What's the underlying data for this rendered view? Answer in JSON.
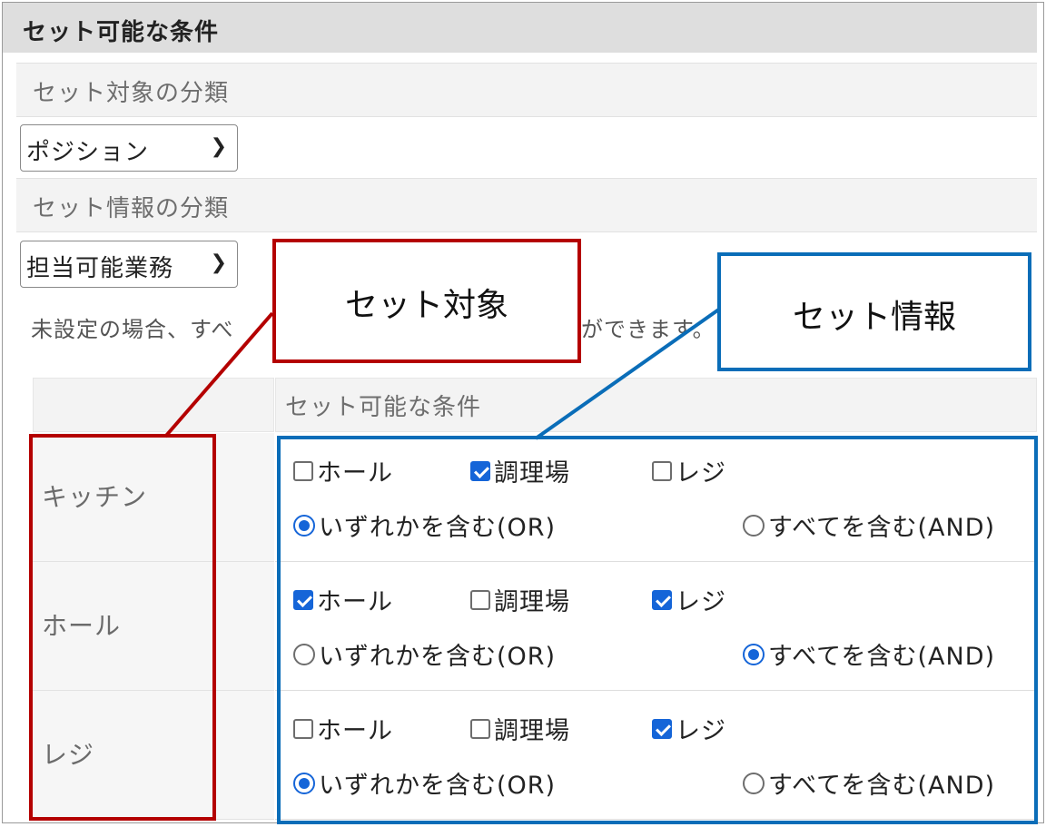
{
  "header": {
    "title": "セット可能な条件"
  },
  "target_section": {
    "label": "セット対象の分類",
    "select_value": "ポジション"
  },
  "info_section": {
    "label": "セット情報の分類",
    "select_value": "担当可能業務"
  },
  "note": "未設定の場合、すべ",
  "note_tail": "ができます。",
  "table": {
    "header": "セット可能な条件",
    "rows": [
      {
        "label": "キッチン",
        "checkboxes": [
          {
            "label": "ホール",
            "checked": false
          },
          {
            "label": "調理場",
            "checked": true
          },
          {
            "label": "レジ",
            "checked": false
          }
        ],
        "radios": [
          {
            "label": "いずれかを含む(OR)",
            "selected": true
          },
          {
            "label": "すべてを含む(AND)",
            "selected": false
          }
        ]
      },
      {
        "label": "ホール",
        "checkboxes": [
          {
            "label": "ホール",
            "checked": true
          },
          {
            "label": "調理場",
            "checked": false
          },
          {
            "label": "レジ",
            "checked": true
          }
        ],
        "radios": [
          {
            "label": "いずれかを含む(OR)",
            "selected": false
          },
          {
            "label": "すべてを含む(AND)",
            "selected": true
          }
        ]
      },
      {
        "label": "レジ",
        "checkboxes": [
          {
            "label": "ホール",
            "checked": false
          },
          {
            "label": "調理場",
            "checked": false
          },
          {
            "label": "レジ",
            "checked": true
          }
        ],
        "radios": [
          {
            "label": "いずれかを含む(OR)",
            "selected": true
          },
          {
            "label": "すべてを含む(AND)",
            "selected": false
          }
        ]
      }
    ]
  },
  "callouts": {
    "target": "セット対象",
    "info": "セット情報"
  },
  "colors": {
    "checked": "#1565d8",
    "callout_red": "#b40000",
    "callout_blue": "#0a6db8"
  },
  "icons": {
    "select_arrow": "chevron-down-icon"
  }
}
